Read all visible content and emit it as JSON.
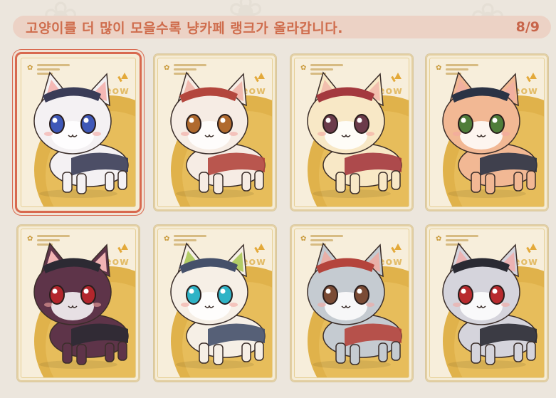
{
  "banner": {
    "message": "고양이를 더 많이 모을수록 냥카페 랭크가 올라갑니다.",
    "count": "8/9"
  },
  "stamp_text": "meow",
  "cards": [
    {
      "name": "cat-card-1",
      "fur": "#f4f1f3",
      "accent": "#3a3c57",
      "eyes": "#3f58b8",
      "ear": "#f4b8b5",
      "selected": true
    },
    {
      "name": "cat-card-2",
      "fur": "#f6ece4",
      "accent": "#b3463d",
      "eyes": "#b06a2e",
      "ear": "#f0b9ae",
      "selected": false
    },
    {
      "name": "cat-card-3",
      "fur": "#f8e8c6",
      "accent": "#a4393e",
      "eyes": "#6b3b4a",
      "ear": "#f2bfae",
      "selected": false
    },
    {
      "name": "cat-card-4",
      "fur": "#f2b894",
      "accent": "#2b3345",
      "eyes": "#4f7d3a",
      "ear": "#f1b0a0",
      "selected": false
    },
    {
      "name": "cat-card-5",
      "fur": "#5e3449",
      "accent": "#2c2a33",
      "eyes": "#b3262c",
      "ear": "#f2b4b4",
      "selected": false
    },
    {
      "name": "cat-card-6",
      "fur": "#f6efe6",
      "accent": "#45506a",
      "eyes": "#2fb3c6",
      "ear": "#b2cc66",
      "selected": false
    },
    {
      "name": "cat-card-7",
      "fur": "#c5cbd1",
      "accent": "#b4443c",
      "eyes": "#7a4b35",
      "ear": "#e9b0a8",
      "selected": false
    },
    {
      "name": "cat-card-8",
      "fur": "#d5d4dc",
      "accent": "#2a2a33",
      "eyes": "#b82a2e",
      "ear": "#ecb3b3",
      "selected": false
    }
  ]
}
